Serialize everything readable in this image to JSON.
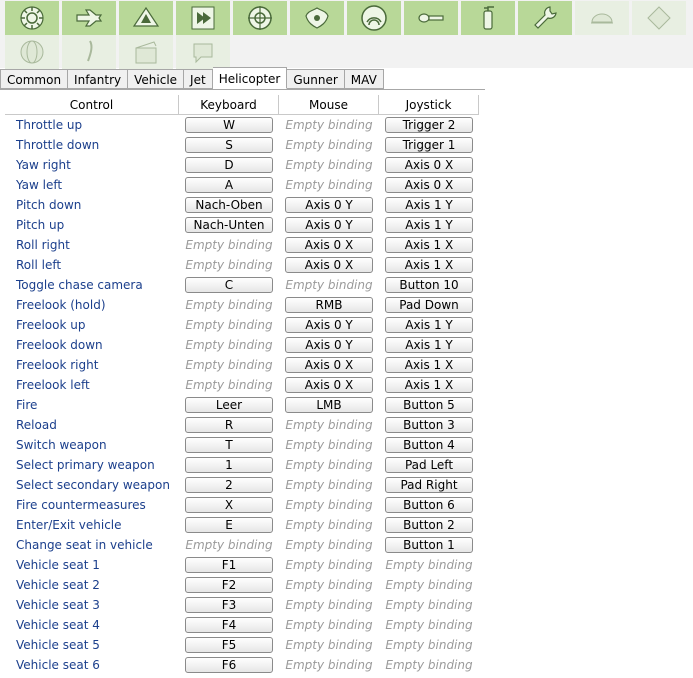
{
  "tabs": [
    "Common",
    "Infantry",
    "Vehicle",
    "Jet",
    "Helicopter",
    "Gunner",
    "MAV"
  ],
  "active_tab": "Helicopter",
  "toolbar_icons": [
    "gear-icon",
    "plane-icon",
    "delta-wing-icon",
    "film-forward-icon",
    "crosshair-icon",
    "shield-wings-icon",
    "radar-icon",
    "key-icon",
    "extinguisher-icon",
    "wrench-icon",
    "dome-icon",
    "diamond-icon",
    "globe-icon",
    "feather-icon",
    "clapper-icon",
    "bubble-icon"
  ],
  "headers": {
    "control": "Control",
    "keyboard": "Keyboard",
    "mouse": "Mouse",
    "joystick": "Joystick"
  },
  "empty_label": "Empty binding",
  "rows": [
    {
      "control": "Throttle up",
      "keyboard": "W",
      "mouse": "",
      "joystick": "Trigger 2"
    },
    {
      "control": "Throttle down",
      "keyboard": "S",
      "mouse": "",
      "joystick": "Trigger 1"
    },
    {
      "control": "Yaw right",
      "keyboard": "D",
      "mouse": "",
      "joystick": "Axis 0 X"
    },
    {
      "control": "Yaw left",
      "keyboard": "A",
      "mouse": "",
      "joystick": "Axis 0 X"
    },
    {
      "control": "Pitch down",
      "keyboard": "Nach-Oben",
      "mouse": "Axis 0 Y",
      "joystick": "Axis 1 Y"
    },
    {
      "control": "Pitch up",
      "keyboard": "Nach-Unten",
      "mouse": "Axis 0 Y",
      "joystick": "Axis 1 Y"
    },
    {
      "control": "Roll right",
      "keyboard": "",
      "mouse": "Axis 0 X",
      "joystick": "Axis 1 X"
    },
    {
      "control": "Roll left",
      "keyboard": "",
      "mouse": "Axis 0 X",
      "joystick": "Axis 1 X"
    },
    {
      "control": "Toggle chase camera",
      "keyboard": "C",
      "mouse": "",
      "joystick": "Button 10"
    },
    {
      "control": "Freelook (hold)",
      "keyboard": "",
      "mouse": "RMB",
      "joystick": "Pad Down"
    },
    {
      "control": "Freelook up",
      "keyboard": "",
      "mouse": "Axis 0 Y",
      "joystick": "Axis 1 Y"
    },
    {
      "control": "Freelook down",
      "keyboard": "",
      "mouse": "Axis 0 Y",
      "joystick": "Axis 1 Y"
    },
    {
      "control": "Freelook right",
      "keyboard": "",
      "mouse": "Axis 0 X",
      "joystick": "Axis 1 X"
    },
    {
      "control": "Freelook left",
      "keyboard": "",
      "mouse": "Axis 0 X",
      "joystick": "Axis 1 X"
    },
    {
      "control": "Fire",
      "keyboard": "Leer",
      "mouse": "LMB",
      "joystick": "Button 5"
    },
    {
      "control": "Reload",
      "keyboard": "R",
      "mouse": "",
      "joystick": "Button 3"
    },
    {
      "control": "Switch weapon",
      "keyboard": "T",
      "mouse": "",
      "joystick": "Button 4"
    },
    {
      "control": "Select primary weapon",
      "keyboard": "1",
      "mouse": "",
      "joystick": "Pad Left"
    },
    {
      "control": "Select secondary weapon",
      "keyboard": "2",
      "mouse": "",
      "joystick": "Pad Right"
    },
    {
      "control": "Fire countermeasures",
      "keyboard": "X",
      "mouse": "",
      "joystick": "Button 6"
    },
    {
      "control": "Enter/Exit vehicle",
      "keyboard": "E",
      "mouse": "",
      "joystick": "Button 2"
    },
    {
      "control": "Change seat in vehicle",
      "keyboard": "",
      "mouse": "",
      "joystick": "Button 1"
    },
    {
      "control": "Vehicle seat 1",
      "keyboard": "F1",
      "mouse": "",
      "joystick": ""
    },
    {
      "control": "Vehicle seat 2",
      "keyboard": "F2",
      "mouse": "",
      "joystick": ""
    },
    {
      "control": "Vehicle seat 3",
      "keyboard": "F3",
      "mouse": "",
      "joystick": ""
    },
    {
      "control": "Vehicle seat 4",
      "keyboard": "F4",
      "mouse": "",
      "joystick": ""
    },
    {
      "control": "Vehicle seat 5",
      "keyboard": "F5",
      "mouse": "",
      "joystick": ""
    },
    {
      "control": "Vehicle seat 6",
      "keyboard": "F6",
      "mouse": "",
      "joystick": ""
    }
  ]
}
